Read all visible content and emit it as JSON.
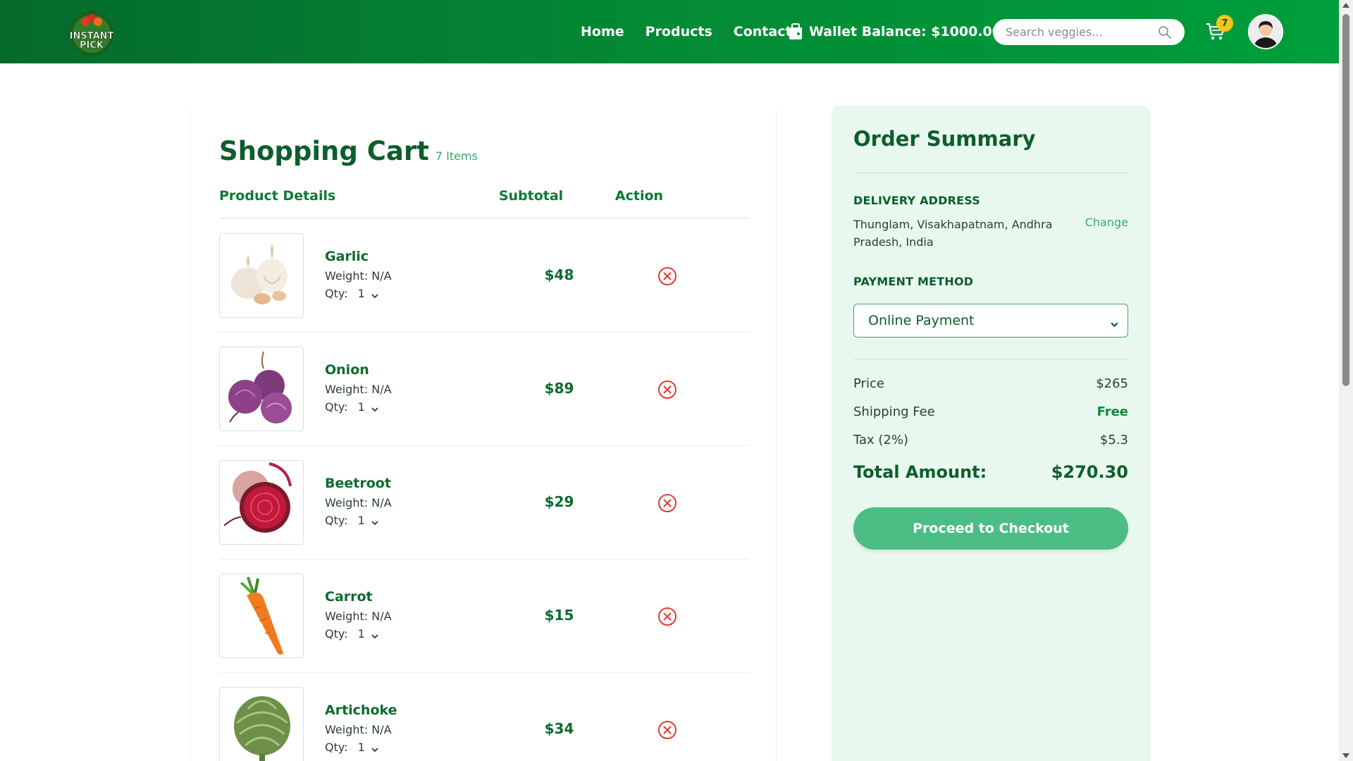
{
  "nav": {
    "logo_text_line1": "INSTANT",
    "logo_text_line2": "PICK",
    "links": [
      "Home",
      "Products",
      "Contact"
    ],
    "wallet_label": "Wallet Balance: $1000.00",
    "search_placeholder": "Search veggies...",
    "cart_count": "7"
  },
  "cart": {
    "title": "Shopping Cart",
    "item_count": "7 Items",
    "headers": {
      "details": "Product Details",
      "subtotal": "Subtotal",
      "action": "Action"
    },
    "qty_label": "Qty:",
    "items": [
      {
        "name": "Garlic",
        "weight": "Weight: N/A",
        "qty": "1",
        "subtotal": "$48",
        "image": "garlic"
      },
      {
        "name": "Onion",
        "weight": "Weight: N/A",
        "qty": "1",
        "subtotal": "$89",
        "image": "onion"
      },
      {
        "name": "Beetroot",
        "weight": "Weight: N/A",
        "qty": "1",
        "subtotal": "$29",
        "image": "beetroot"
      },
      {
        "name": "Carrot",
        "weight": "Weight: N/A",
        "qty": "1",
        "subtotal": "$15",
        "image": "carrot"
      },
      {
        "name": "Artichoke",
        "weight": "Weight: N/A",
        "qty": "1",
        "subtotal": "$34",
        "image": "artichoke"
      }
    ]
  },
  "summary": {
    "title": "Order Summary",
    "delivery_label": "DELIVERY ADDRESS",
    "address": "Thunglam, Visakhapatnam, Andhra Pradesh, India",
    "change_label": "Change",
    "payment_label": "PAYMENT METHOD",
    "payment_value": "Online Payment",
    "price_label": "Price",
    "price_value": "$265",
    "shipping_label": "Shipping Fee",
    "shipping_value": "Free",
    "tax_label": "Tax (2%)",
    "tax_value": "$5.3",
    "total_label": "Total Amount:",
    "total_value": "$270.30",
    "checkout_label": "Proceed to Checkout"
  },
  "colors": {
    "nav_green": "#038a35",
    "brand_dark_green": "#0c5e2a",
    "accent_green": "#4cbd84",
    "remove_red": "#e53935",
    "badge_yellow": "#f5c518",
    "summary_bg": "#e9f8ef"
  }
}
